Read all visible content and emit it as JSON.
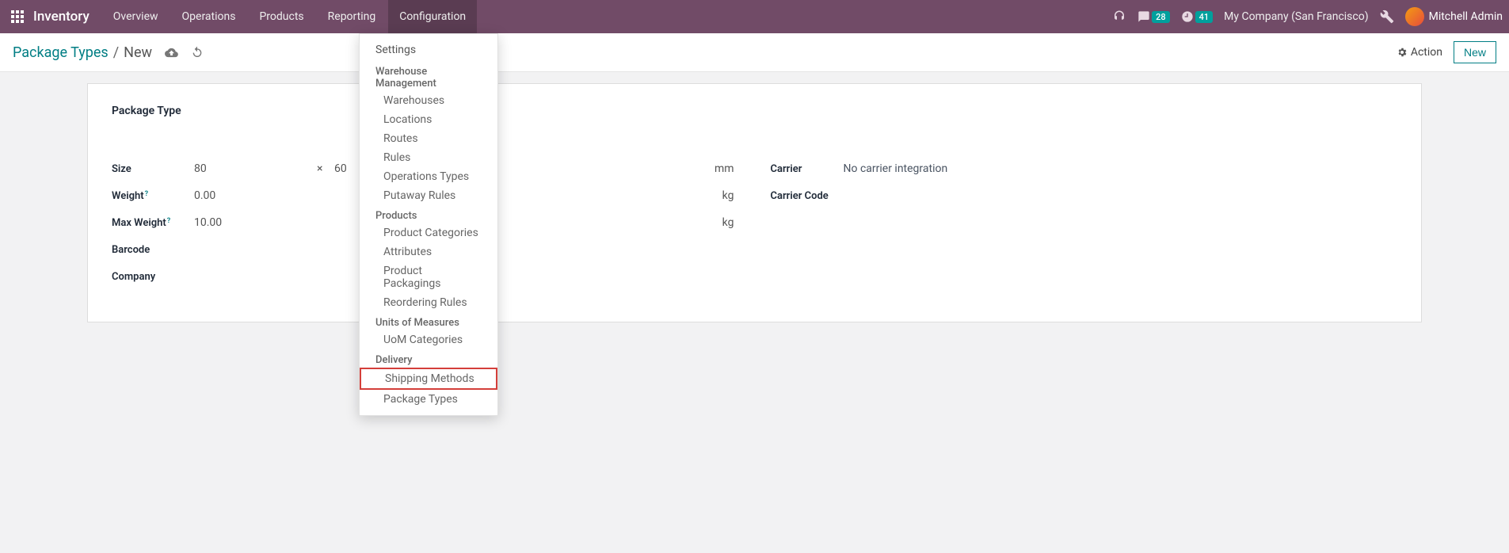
{
  "nav": {
    "brand": "Inventory",
    "items": [
      "Overview",
      "Operations",
      "Products",
      "Reporting",
      "Configuration"
    ],
    "active": "Configuration",
    "messages_badge": "28",
    "activities_badge": "41",
    "company": "My Company (San Francisco)",
    "user": "Mitchell Admin"
  },
  "breadcrumb": {
    "root": "Package Types",
    "current": "New"
  },
  "actions": {
    "action_label": "Action",
    "new_label": "New"
  },
  "form": {
    "title_label": "Package Type",
    "size_label": "Size",
    "size_l": "80",
    "size_cross": "×",
    "size_w": "60",
    "size_unit": "mm",
    "weight_label": "Weight",
    "weight_val": "0.00",
    "weight_unit": "kg",
    "maxw_label": "Max Weight",
    "maxw_val": "10.00",
    "maxw_unit": "kg",
    "barcode_label": "Barcode",
    "company_label": "Company",
    "carrier_label": "Carrier",
    "carrier_val": "No carrier integration",
    "carrier_code_label": "Carrier Code"
  },
  "dropdown": {
    "settings": "Settings",
    "h_warehouse": "Warehouse Management",
    "warehouses": "Warehouses",
    "locations": "Locations",
    "routes": "Routes",
    "rules": "Rules",
    "op_types": "Operations Types",
    "putaway": "Putaway Rules",
    "h_products": "Products",
    "prod_cat": "Product Categories",
    "attributes": "Attributes",
    "prod_pack": "Product Packagings",
    "reorder": "Reordering Rules",
    "h_uom": "Units of Measures",
    "uom_cat": "UoM Categories",
    "h_delivery": "Delivery",
    "shipping": "Shipping Methods",
    "pkg_types": "Package Types"
  }
}
